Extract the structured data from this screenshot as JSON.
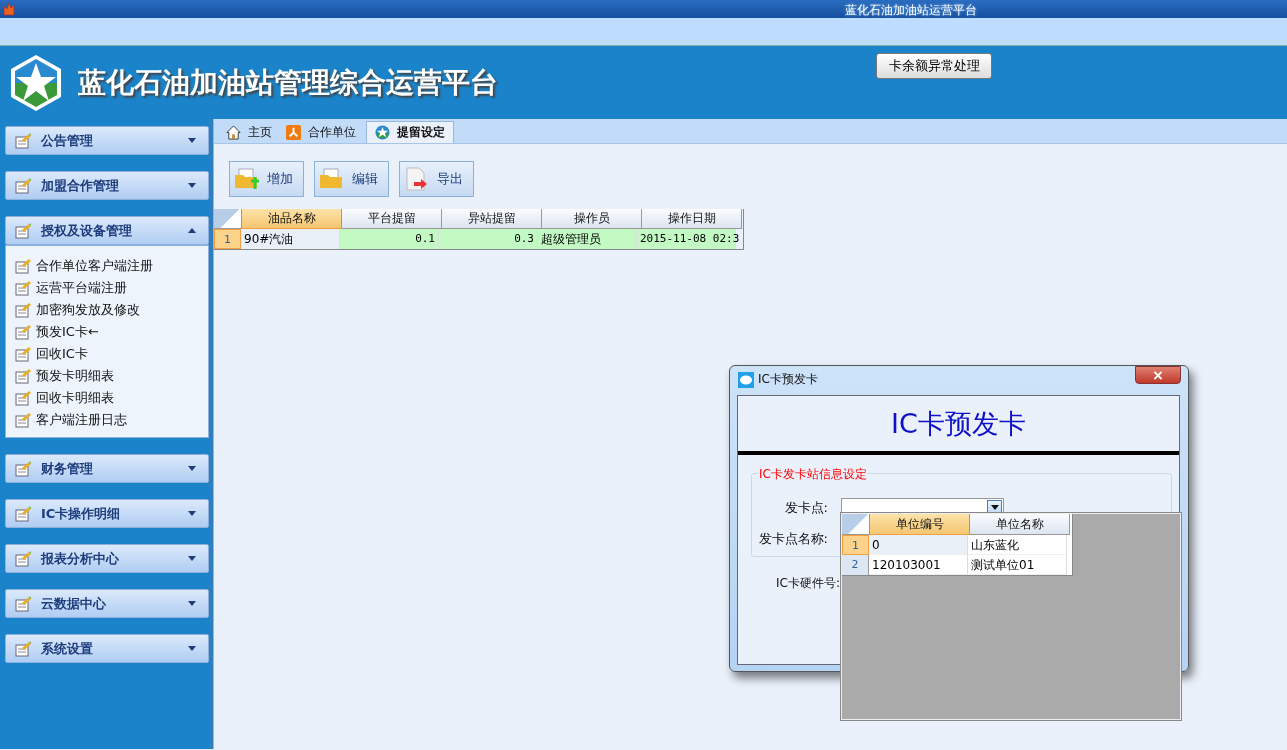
{
  "window": {
    "title": "蓝化石油加油站运营平台"
  },
  "header": {
    "app_name": "蓝化石油加油站管理综合运营平台",
    "button": "卡余额异常处理"
  },
  "sidebar": {
    "sections": [
      {
        "label": "公告管理",
        "expanded": false
      },
      {
        "label": "加盟合作管理",
        "expanded": false
      },
      {
        "label": "授权及设备管理",
        "expanded": true,
        "children": [
          {
            "label": "合作单位客户端注册"
          },
          {
            "label": "运营平台端注册"
          },
          {
            "label": "加密狗发放及修改"
          },
          {
            "label": "预发IC卡←"
          },
          {
            "label": "回收IC卡"
          },
          {
            "label": "预发卡明细表"
          },
          {
            "label": "回收卡明细表"
          },
          {
            "label": "客户端注册日志"
          }
        ]
      },
      {
        "label": "财务管理",
        "expanded": false
      },
      {
        "label": "IC卡操作明细",
        "expanded": false
      },
      {
        "label": "报表分析中心",
        "expanded": false
      },
      {
        "label": "云数据中心",
        "expanded": false
      },
      {
        "label": "系统设置",
        "expanded": false
      }
    ]
  },
  "tabs": [
    {
      "label": "主页",
      "kind": "home",
      "selected": false
    },
    {
      "label": "合作单位",
      "kind": "org",
      "selected": false
    },
    {
      "label": "提留设定",
      "kind": "star",
      "selected": true
    }
  ],
  "toolbar": [
    {
      "label": "增加",
      "kind": "add"
    },
    {
      "label": "编辑",
      "kind": "edit"
    },
    {
      "label": "导出",
      "kind": "export"
    }
  ],
  "table": {
    "columns": [
      "油品名称",
      "平台提留",
      "异站提留",
      "操作员",
      "操作日期"
    ],
    "rows": [
      {
        "number": "1",
        "selected": true,
        "cells": [
          "90#汽油",
          "0.1",
          "0.3",
          "超级管理员",
          "2015-11-08 02:3"
        ]
      }
    ]
  },
  "dialog": {
    "title": "IC卡预发卡",
    "heading": "IC卡预发卡",
    "group_title": "IC卡发卡站信息设定",
    "fields": [
      {
        "label": "发卡点:"
      },
      {
        "label": "发卡点名称:"
      },
      {
        "label": "IC卡硬件号:"
      }
    ],
    "dropdown": {
      "columns": [
        "单位编号",
        "单位名称"
      ],
      "rows": [
        {
          "number": "1",
          "selected": true,
          "cells": [
            "0",
            "山东蓝化"
          ]
        },
        {
          "number": "2",
          "selected": false,
          "cells": [
            "120103001",
            "测试单位01"
          ]
        }
      ]
    }
  }
}
